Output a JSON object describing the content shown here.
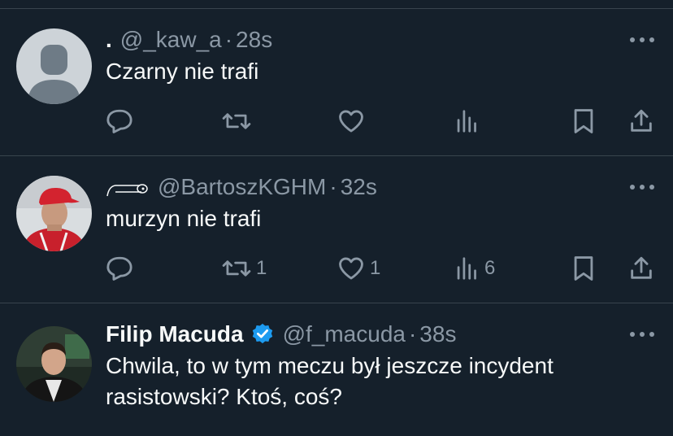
{
  "colors": {
    "background": "#15202b",
    "text_primary": "#f7f9f9",
    "text_secondary": "#8b98a5",
    "divider": "#38444d",
    "verified": "#1d9bf0"
  },
  "tweets": [
    {
      "display_name": ".",
      "handle": "@_kaw_a",
      "separator": "·",
      "time": "28s",
      "text": "Czarny nie trafi",
      "avatar": "default-avatar-icon",
      "counts": {
        "reply": "",
        "retweet": "",
        "like": "",
        "views": ""
      }
    },
    {
      "display_name": "",
      "name_icon": "ornament-icon",
      "handle": "@BartoszKGHM",
      "separator": "·",
      "time": "32s",
      "text": "murzyn nie trafi",
      "avatar": "user-photo",
      "counts": {
        "reply": "",
        "retweet": "1",
        "like": "1",
        "views": "6"
      }
    },
    {
      "display_name": "Filip Macuda",
      "verified": true,
      "handle": "@f_macuda",
      "separator": "·",
      "time": "38s",
      "text_line1": "Chwila, to w tym meczu był jeszcze incydent",
      "text_line2": "rasistowski? Ktoś, coś?",
      "avatar": "user-photo"
    }
  ]
}
